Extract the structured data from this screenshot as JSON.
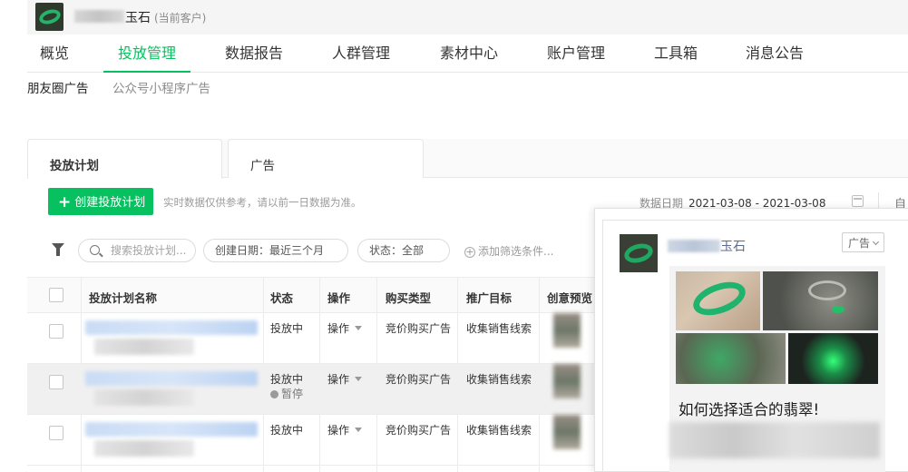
{
  "account": {
    "name": "玉石",
    "tag": "(当前客户)"
  },
  "nav": [
    {
      "label": "概览"
    },
    {
      "label": "投放管理"
    },
    {
      "label": "数据报告"
    },
    {
      "label": "人群管理"
    },
    {
      "label": "素材中心"
    },
    {
      "label": "账户管理"
    },
    {
      "label": "工具箱"
    },
    {
      "label": "消息公告"
    }
  ],
  "subnav": [
    {
      "label": "朋友圈广告"
    },
    {
      "label": "公众号小程序广告"
    }
  ],
  "tabs": [
    {
      "label": "投放计划"
    },
    {
      "label": "广告"
    }
  ],
  "toolbar": {
    "create_label": "创建投放计划",
    "tip": "实时数据仅供参考，请以前一日数据为准。",
    "date_label": "数据日期",
    "date_value": "2021-03-08 - 2021-03-08",
    "right_truncated": "自"
  },
  "filters": {
    "search_placeholder": "搜索投放计划...",
    "created": "创建日期：最近三个月",
    "status": "状态：全部",
    "add": "添加筛选条件..."
  },
  "table": {
    "columns": [
      "投放计划名称",
      "状态",
      "操作",
      "购买类型",
      "推广目标",
      "创意预览"
    ],
    "rows": [
      {
        "status": "投放中",
        "action": "操作",
        "buy_type": "竞价购买广告",
        "goal": "收集销售线索"
      },
      {
        "status": "投放中",
        "paused": "暂停",
        "action": "操作",
        "buy_type": "竞价购买广告",
        "goal": "收集销售线索"
      },
      {
        "status": "投放中",
        "action": "操作",
        "buy_type": "竞价购买广告",
        "goal": "收集销售线索"
      }
    ]
  },
  "preview": {
    "name": "玉石",
    "ad_badge": "广告",
    "headline": "如何选择适合的翡翠!"
  },
  "colors": {
    "accent": "#07c160"
  }
}
